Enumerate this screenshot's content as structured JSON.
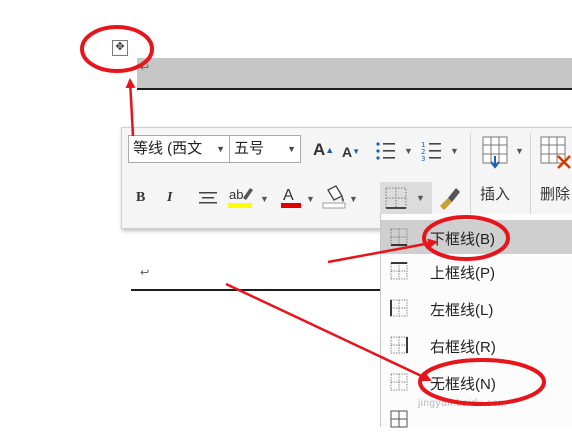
{
  "document": {
    "move_handle_icon": "move-cross-icon",
    "paragraph_mark": "↩",
    "paragraph_mark_2": "↩"
  },
  "toolbar": {
    "font_name": "等线 (西文",
    "font_size": "五号",
    "insert_label": "插入",
    "delete_label": "删除"
  },
  "border_menu": {
    "items": [
      {
        "label": "下框线(B)",
        "icon": "bottom-border-icon",
        "highlighted": true
      },
      {
        "label": "上框线(P)",
        "icon": "top-border-icon"
      },
      {
        "label": "左框线(L)",
        "icon": "left-border-icon"
      },
      {
        "label": "右框线(R)",
        "icon": "right-border-icon"
      },
      {
        "label": "无框线(N)",
        "icon": "no-border-icon"
      }
    ]
  },
  "watermark": "jingyan.baidu.com",
  "colors": {
    "annotation_red": "#e8141c",
    "highlight_yellow": "#ffff00",
    "font_red": "#e00000",
    "selection_gray": "#c6c6c6"
  }
}
